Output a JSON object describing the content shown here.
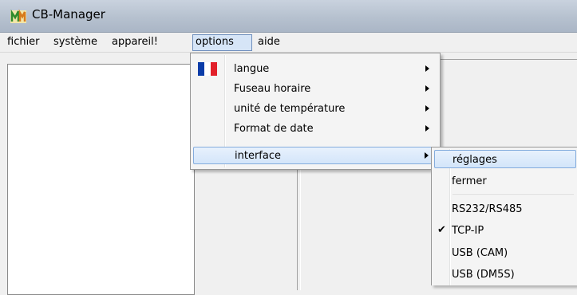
{
  "window": {
    "title": "CB-Manager",
    "icon": "cb-manager-logo-icon"
  },
  "menubar": {
    "items": [
      {
        "label": "fichier"
      },
      {
        "label": "système"
      },
      {
        "label": "appareil!"
      },
      {
        "label": "options"
      },
      {
        "label": "aide"
      }
    ]
  },
  "options_menu": {
    "items": [
      {
        "label": "langue",
        "icon": "french-flag-icon",
        "submenu": true
      },
      {
        "label": "Fuseau horaire",
        "submenu": true
      },
      {
        "label": "unité de température",
        "submenu": true
      },
      {
        "label": "Format de date",
        "submenu": true
      },
      {
        "label": "interface",
        "submenu": true,
        "highlighted": true
      }
    ]
  },
  "interface_submenu": {
    "items": [
      {
        "label": "réglages",
        "highlighted": true
      },
      {
        "label": "fermer"
      },
      {
        "label": "RS232/RS485"
      },
      {
        "label": "TCP-IP",
        "checked": true,
        "check_glyph": "✔"
      },
      {
        "label": "USB (CAM)"
      },
      {
        "label": "USB (DM5S)"
      }
    ]
  },
  "colors": {
    "highlight_border": "#84acdd",
    "menu_bg": "#f4f4f4",
    "flag_blue": "#0a3ca8",
    "flag_red": "#e2202a"
  }
}
